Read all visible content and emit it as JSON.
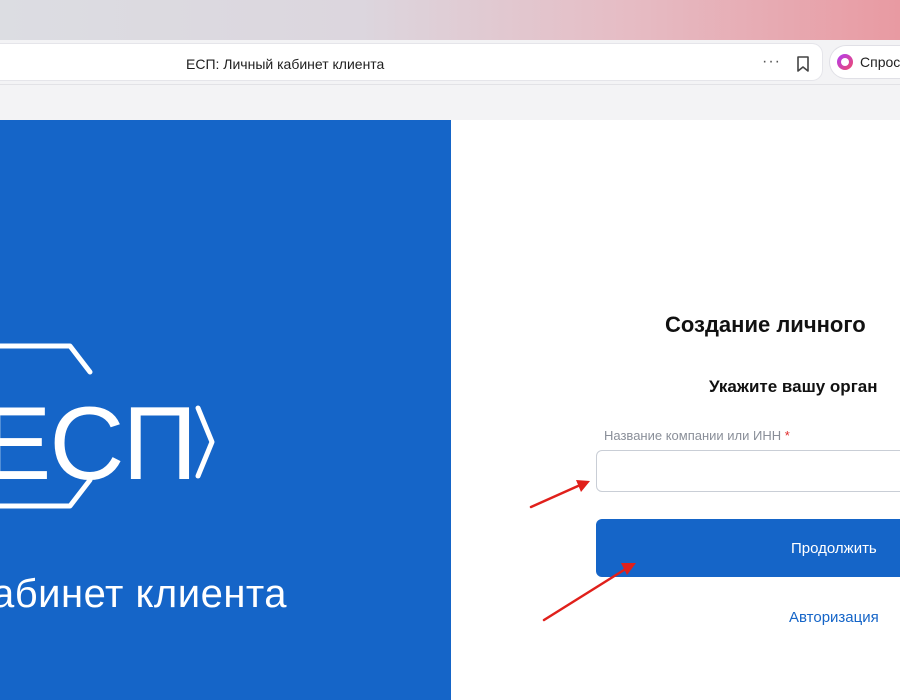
{
  "browser": {
    "tab_title": "ЕСП: Личный кабинет клиента",
    "more_glyph": "···",
    "ask_label": "Спрос",
    "icons": [
      "more-icon",
      "bookmark-icon",
      "alice-icon"
    ]
  },
  "brand": {
    "logo_text": "ЕСП",
    "subtitle": "абинет клиента",
    "background_color": "#1565c8"
  },
  "form": {
    "title": "Создание личного",
    "subtitle": "Укажите вашу орган",
    "field_label": "Название компании или ИНН",
    "required_marker": "*",
    "input_value": "",
    "continue_label": "Продолжить",
    "auth_link": "Авторизация",
    "accent_color": "#1565c8"
  },
  "annotations": {
    "arrow_color": "#e0201b",
    "arrows": [
      "points-to-company-input",
      "points-to-continue-button"
    ]
  }
}
